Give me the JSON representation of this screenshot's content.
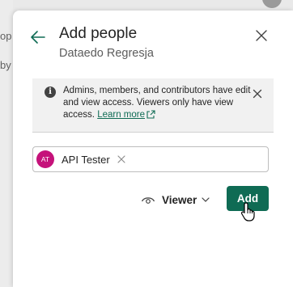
{
  "background": {
    "fragment_1": "op",
    "fragment_2": "by"
  },
  "dialog": {
    "title": "Add people",
    "subtitle": "Dataedo Regresja",
    "back_icon": "arrow-left-icon",
    "close_icon": "close-icon"
  },
  "info": {
    "icon": "info-icon",
    "text": "Admins, members, and contributors have edit and view access. Viewers only have view access.",
    "link": "Learn more",
    "link_icon": "external-link-icon",
    "close_icon": "close-icon"
  },
  "people": {
    "chip": {
      "initials": "AT",
      "name": "API Tester",
      "remove_icon": "close-icon"
    }
  },
  "permission": {
    "icon": "eye-icon",
    "label": "Viewer",
    "chevron": "chevron-down-icon"
  },
  "actions": {
    "add_label": "Add"
  },
  "colors": {
    "accent": "#0f6b54",
    "avatar": "#c5127a",
    "info_background": "#f1f1f1"
  }
}
